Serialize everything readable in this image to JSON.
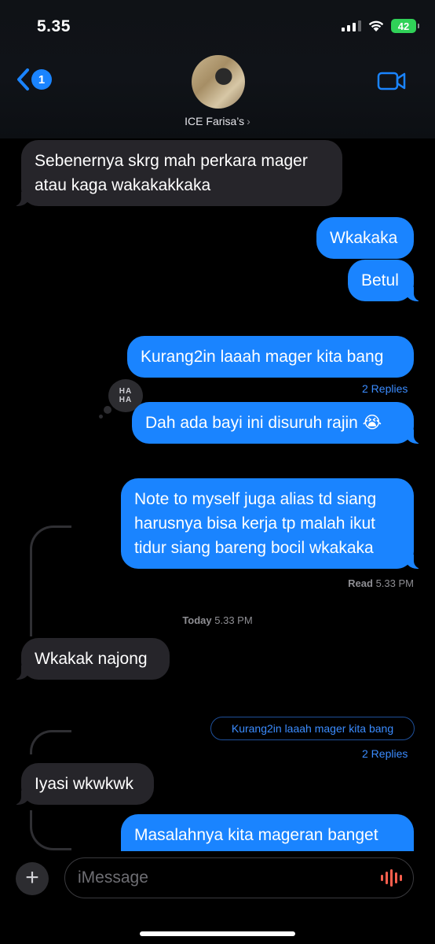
{
  "status_bar": {
    "time": "5.35",
    "battery": "42"
  },
  "header": {
    "back_badge": "1",
    "contact_name": "ICE Farisa’s",
    "contact_chevron": "›",
    "icons": {
      "back": "chevron-left-icon",
      "video": "video-camera-icon"
    },
    "accent": "#1a84ff"
  },
  "messages": [
    {
      "from": "them",
      "text": "Sebenernya skrg mah perkara mager\natau kaga wakakakkaka"
    },
    {
      "from": "me",
      "text": "Wkakaka"
    },
    {
      "from": "me",
      "text": "Betul"
    },
    {
      "from": "me",
      "text": "Kurang2in laaah mager kita bang"
    },
    {
      "from": "me",
      "text": "Dah ada bayi ini disuruh rajin 😭"
    },
    {
      "from": "me",
      "text": "Note to myself juga alias td siang\nharusnya bisa kerja tp malah ikut\ntidur siang bareng bocil wkakaka"
    },
    {
      "from": "them",
      "text": "Wkakak najong"
    },
    {
      "from": "them",
      "text": "Iyasi wkwkwk"
    },
    {
      "from": "me",
      "text": "Masalahnya kita mageran banget"
    }
  ],
  "tapback": {
    "text_top": "HA",
    "text_bottom": "HA"
  },
  "replies_1": "2 Replies",
  "replies_2": "2 Replies",
  "receipt": {
    "label": "Read",
    "time": "5.33 PM"
  },
  "timestamp": {
    "day": "Today",
    "time": "5.33 PM"
  },
  "reply_context": "Kurang2in laaah mager kita bang",
  "composer": {
    "placeholder": "iMessage",
    "plus": "+"
  },
  "colors": {
    "outgoing": "#1a84ff",
    "incoming": "#26252a",
    "background": "#000000",
    "mic": "#ff5f4d"
  }
}
